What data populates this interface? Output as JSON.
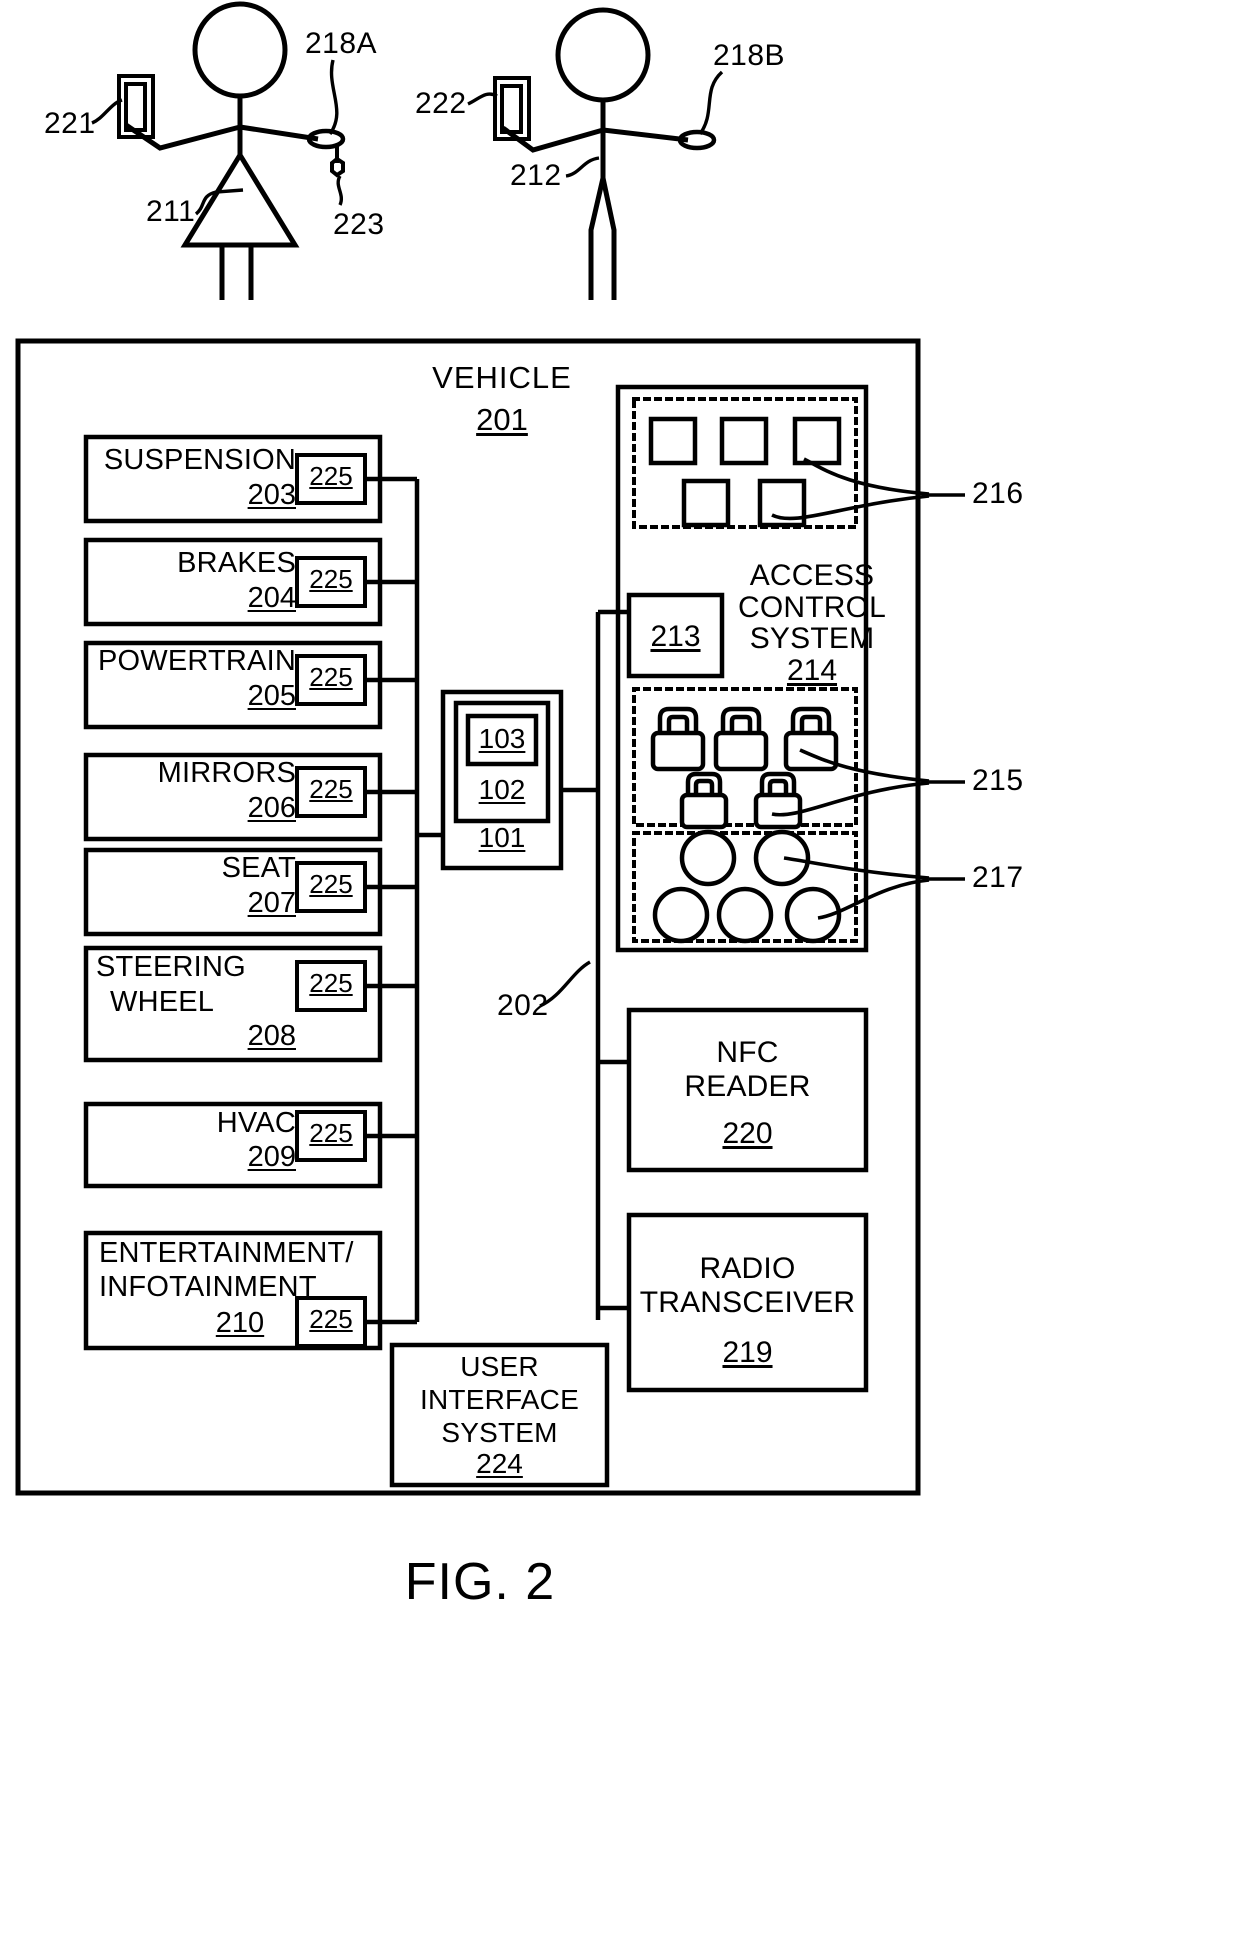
{
  "figure": {
    "caption": "FIG. 2",
    "title": "Vehicle access control system block diagram"
  },
  "actors": [
    {
      "id": "actor-1",
      "kind": "stick-figure-with-dress",
      "body_ref": "211",
      "phone_ref": "221",
      "wearable_ref": "218A",
      "keyfob_ref": "223"
    },
    {
      "id": "actor-2",
      "kind": "stick-figure",
      "body_ref": "212",
      "phone_ref": "222",
      "wearable_ref": "218B"
    }
  ],
  "vehicle": {
    "label": "VEHICLE",
    "ref": "201",
    "bus_ref": "202"
  },
  "subsystems": [
    {
      "label": "SUSPENSION",
      "ref": "203",
      "sensor_ref": "225",
      "lines": [
        "SUSPENSION"
      ]
    },
    {
      "label": "BRAKES",
      "ref": "204",
      "sensor_ref": "225",
      "lines": [
        "BRAKES"
      ]
    },
    {
      "label": "POWERTRAIN",
      "ref": "205",
      "sensor_ref": "225",
      "lines": [
        "POWERTRAIN"
      ]
    },
    {
      "label": "MIRRORS",
      "ref": "206",
      "sensor_ref": "225",
      "lines": [
        "MIRRORS"
      ]
    },
    {
      "label": "SEAT",
      "ref": "207",
      "sensor_ref": "225",
      "lines": [
        "SEAT"
      ]
    },
    {
      "label": "STEERING WHEEL",
      "ref": "208",
      "sensor_ref": "225",
      "lines": [
        "STEERING",
        "WHEEL"
      ]
    },
    {
      "label": "HVAC",
      "ref": "209",
      "sensor_ref": "225",
      "lines": [
        "HVAC"
      ]
    },
    {
      "label": "ENTERTAINMENT/INFOTAINMENT",
      "ref": "210",
      "sensor_ref": "225",
      "lines": [
        "ENTERTAINMENT/",
        "INFOTAINMENT"
      ]
    }
  ],
  "controller": {
    "outer_ref": "101",
    "middle_ref": "102",
    "inner_ref": "103"
  },
  "access_control_system": {
    "lines": [
      "ACCESS",
      "CONTROL",
      "SYSTEM"
    ],
    "ref": "214",
    "module_ref": "213",
    "groups": [
      {
        "name": "windows",
        "ref": "216",
        "icon": "square-icon",
        "count": 5
      },
      {
        "name": "locks",
        "ref": "215",
        "icon": "padlock-icon",
        "count": 5
      },
      {
        "name": "lights",
        "ref": "217",
        "icon": "circle-icon",
        "count": 5
      }
    ]
  },
  "peripherals": [
    {
      "id": "nfc-reader",
      "lines": [
        "NFC",
        "READER"
      ],
      "ref": "220"
    },
    {
      "id": "radio-transceiver",
      "lines": [
        "RADIO",
        "TRANSCEIVER"
      ],
      "ref": "219"
    },
    {
      "id": "user-interface",
      "lines": [
        "USER",
        "INTERFACE",
        "SYSTEM"
      ],
      "ref": "224"
    }
  ]
}
